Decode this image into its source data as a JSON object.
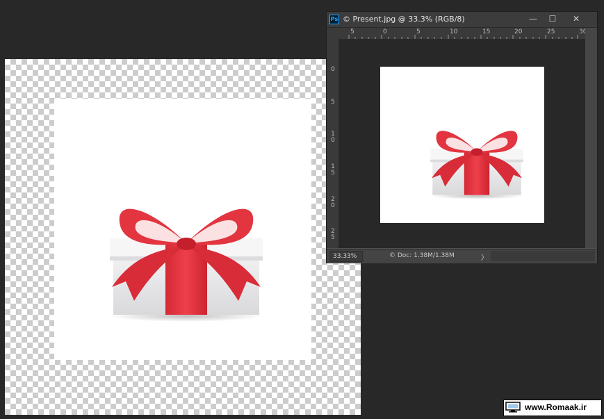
{
  "document": {
    "title": "© Present.jpg @ 33.3% (RGB/8)",
    "ps_logo": "Ps"
  },
  "window_controls": {
    "minimize": "—",
    "maximize": "☐",
    "close": "✕"
  },
  "ruler_top_labels": [
    "5",
    "0",
    "5",
    "10",
    "15",
    "20",
    "25",
    "30"
  ],
  "ruler_left_labels": [
    "0",
    "5",
    "1\n0",
    "1\n5",
    "2\n0",
    "2\n5"
  ],
  "status": {
    "zoom": "33.33%",
    "doc_info": "© Doc: 1.38M/1.38M",
    "arrow": "〉"
  },
  "watermark": {
    "text": "www.Romaak.ir"
  },
  "colors": {
    "ribbon": "#e23540",
    "ribbon_dark": "#c41f2c",
    "box": "#ececed",
    "ps_blue": "#31a8ff",
    "workspace": "#282828"
  },
  "icons": {
    "watermark_icon": "computer-monitor-icon"
  }
}
